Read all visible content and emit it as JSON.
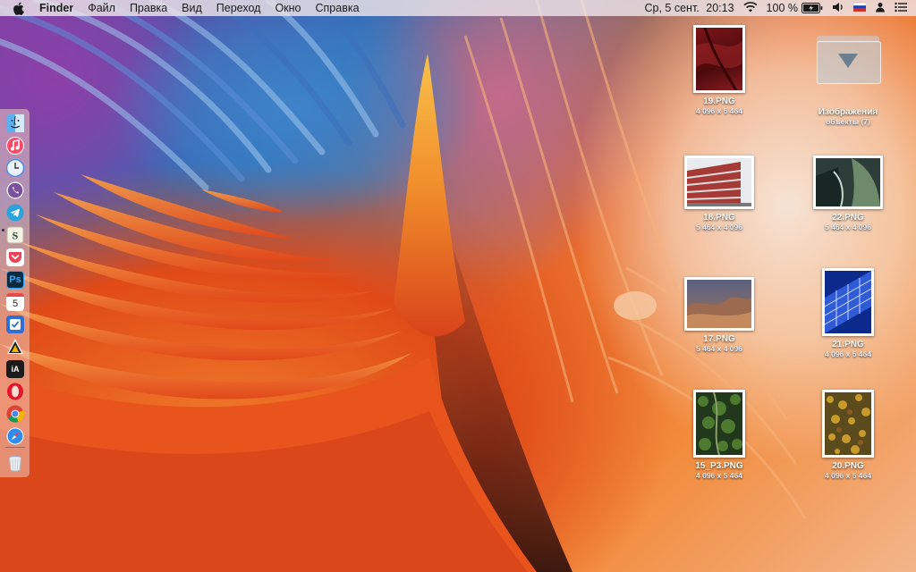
{
  "menubar": {
    "app_name": "Finder",
    "menus": [
      "Файл",
      "Правка",
      "Вид",
      "Переход",
      "Окно",
      "Справка"
    ],
    "day_date": "Ср, 5 сент.",
    "time": "20:13",
    "battery_percent": "100 %"
  },
  "dock": {
    "apps": [
      {
        "name": "Finder",
        "icon": "finder-icon",
        "color": "#4aa3f0"
      },
      {
        "name": "Music",
        "icon": "music-icon",
        "color": "#fa3c5a"
      },
      {
        "name": "Clock",
        "icon": "clock-icon",
        "color": "#4e8ee8"
      },
      {
        "name": "Viber",
        "icon": "viber-icon",
        "color": "#7b519d"
      },
      {
        "name": "Telegram",
        "icon": "telegram-icon",
        "color": "#2aa3dd"
      },
      {
        "name": "Scrivener",
        "icon": "scrivener-icon",
        "color": "#4f7a3a"
      },
      {
        "name": "Pocket",
        "icon": "pocket-icon",
        "color": "#ef4056"
      },
      {
        "name": "Photoshop",
        "icon": "photoshop-icon",
        "color": "#0c2b3e",
        "label": "Ps"
      },
      {
        "name": "Calendar",
        "icon": "calendar-icon",
        "color": "#ffffff",
        "label": "5"
      },
      {
        "name": "Things",
        "icon": "checklist-icon",
        "color": "#2f6fd6"
      },
      {
        "name": "Affinity",
        "icon": "affinity-icon",
        "color": "#f2f2f2"
      },
      {
        "name": "iA Writer",
        "icon": "ia-writer-icon",
        "color": "#1b1b1b",
        "label": "iA"
      },
      {
        "name": "Opera",
        "icon": "opera-icon",
        "color": "#e3162b"
      },
      {
        "name": "Chrome",
        "icon": "chrome-icon",
        "color": "#ffffff"
      },
      {
        "name": "Safari",
        "icon": "safari-icon",
        "color": "#2e8df0"
      }
    ],
    "trash_icon": "trash-icon"
  },
  "desktop": {
    "items": [
      {
        "id": "19",
        "name": "19.PNG",
        "info": "4 096 x 5 464",
        "colors": [
          "#5a0d10",
          "#8a1a1e"
        ]
      },
      {
        "id": "folder",
        "name": "Изображения",
        "info": "объекты (7)"
      },
      {
        "id": "18",
        "name": "18.PNG",
        "info": "5 464 x 4 096",
        "colors": [
          "#e7e7ea",
          "#a23a3a"
        ]
      },
      {
        "id": "22",
        "name": "22.PNG",
        "info": "5 464 x 4 096",
        "colors": [
          "#2d3d3a",
          "#6e8a6a"
        ]
      },
      {
        "id": "17",
        "name": "17.PNG",
        "info": "5 464 x 4 096",
        "colors": [
          "#5a5f80",
          "#b07a58"
        ]
      },
      {
        "id": "21",
        "name": "21.PNG",
        "info": "4 096 x 5 464",
        "colors": [
          "#0b2a8c",
          "#2f5bd6"
        ]
      },
      {
        "id": "15",
        "name": "15_P3.PNG",
        "info": "4 096 x 5 464",
        "colors": [
          "#21381c",
          "#4d7a2e"
        ]
      },
      {
        "id": "20",
        "name": "20.PNG",
        "info": "4 096 x 5 464",
        "colors": [
          "#5a4a1c",
          "#c89a2a"
        ]
      }
    ]
  }
}
